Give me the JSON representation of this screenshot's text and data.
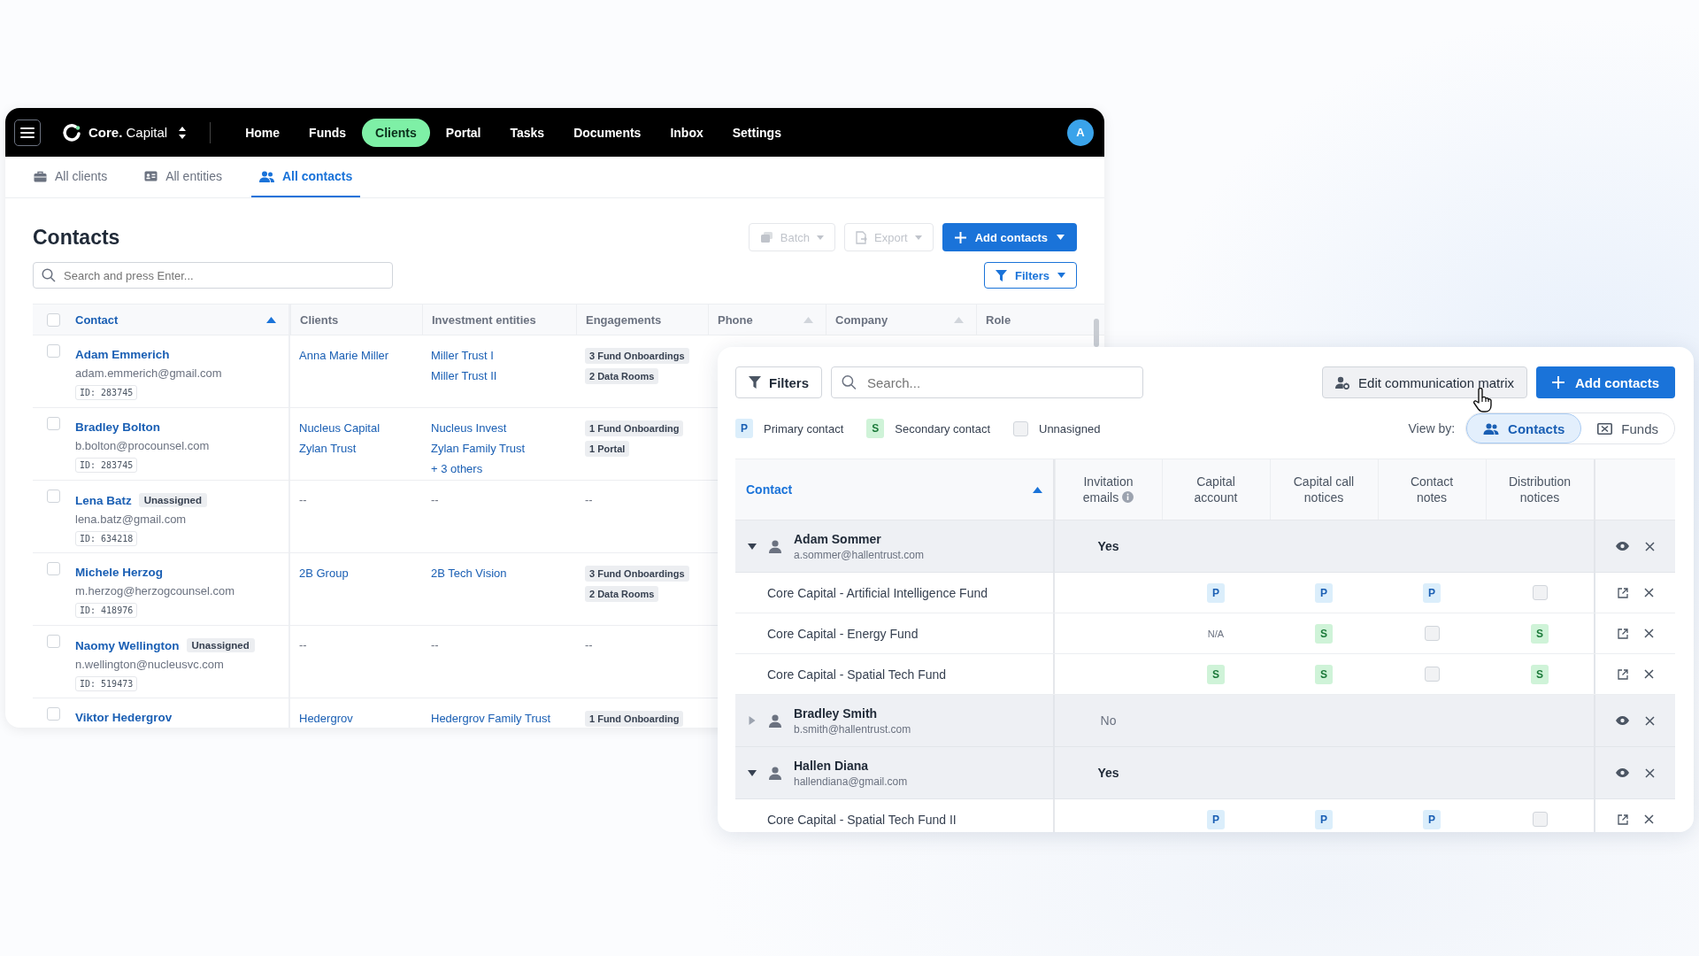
{
  "nav": {
    "brand": "**Core.** Capital",
    "items": [
      {
        "label": "Home",
        "selected": false
      },
      {
        "label": "Funds",
        "selected": false
      },
      {
        "label": "Clients",
        "selected": true
      },
      {
        "label": "Portal",
        "selected": false
      },
      {
        "label": "Tasks",
        "selected": false
      },
      {
        "label": "Documents",
        "selected": false
      },
      {
        "label": "Inbox",
        "selected": false
      },
      {
        "label": "Settings",
        "selected": false
      }
    ],
    "avatar": "A"
  },
  "tabs": [
    {
      "label": "All clients",
      "selected": false
    },
    {
      "label": "All entities",
      "selected": false
    },
    {
      "label": "All contacts",
      "selected": true
    }
  ],
  "contacts_page": {
    "title": "Contacts",
    "tool_buttons": [
      {
        "label": "Batch",
        "disabled": true
      },
      {
        "label": "Export",
        "disabled": true
      }
    ],
    "add_button": "Add contacts",
    "search": {
      "placeholder": "Search and press Enter..."
    },
    "filters_button": "Filters"
  },
  "table": {
    "select_all_checked": false,
    "columns": [
      {
        "label": "Contact",
        "sortable": true,
        "sorted": true
      },
      {
        "label": "Clients",
        "sortable": false,
        "sorted": false
      },
      {
        "label": "Investment entities",
        "sortable": false,
        "sorted": false
      },
      {
        "label": "Engagements",
        "sortable": false,
        "sorted": false
      },
      {
        "label": "Phone",
        "sortable": true,
        "sorted": false
      },
      {
        "label": "Company",
        "sortable": true,
        "sorted": false
      },
      {
        "label": "Role",
        "sortable": false,
        "sorted": false
      }
    ],
    "rows": [
      {
        "checked": false,
        "name": "Adam Emmerich",
        "email": "adam.emmerich@gmail.com",
        "id": "ID: 283745",
        "clients": [
          "Anna Marie Miller"
        ],
        "entities": [
          "Miller Trust I",
          "Miller Trust II"
        ],
        "engagements": [
          "3 Fund Onboardings",
          "2 Data Rooms"
        ]
      },
      {
        "checked": false,
        "name": "Bradley Bolton",
        "email": "b.bolton@procounsel.com",
        "id": "ID: 283745",
        "clients": [
          "Nucleus Capital",
          "Zylan Trust"
        ],
        "entities": [
          "Nucleus Invest",
          "Zylan Family Trust",
          "+ 3 others"
        ],
        "engagements": [
          "1 Fund Onboarding",
          "1 Portal"
        ]
      },
      {
        "checked": false,
        "name": "Lena Batz",
        "badge": "Unassigned",
        "email": "lena.batz@gmail.com",
        "id": "ID: 634218",
        "clients": [
          "--"
        ],
        "entities": [
          "--"
        ],
        "engagements": [
          "--"
        ]
      },
      {
        "checked": false,
        "name": "Michele Herzog",
        "email": "m.herzog@herzogcounsel.com",
        "id": "ID: 418976",
        "clients": [
          "2B Group"
        ],
        "entities": [
          "2B Tech Vision"
        ],
        "engagements": [
          "3 Fund Onboardings",
          "2 Data Rooms"
        ]
      },
      {
        "checked": false,
        "name": "Naomy Wellington",
        "badge": "Unassigned",
        "email": "n.wellington@nucleusvc.com",
        "id": "ID: 519473",
        "clients": [
          "--"
        ],
        "entities": [
          "--"
        ],
        "engagements": [
          "--"
        ]
      },
      {
        "checked": false,
        "name": "Viktor Hedergrov",
        "clients": [
          "Hedergrov"
        ],
        "entities": [
          "Hedergrov Family Trust"
        ],
        "engagements": [
          "1 Fund Onboarding"
        ]
      }
    ]
  },
  "matrix_panel": {
    "filters_button": "Filters",
    "search": {
      "placeholder": "Search..."
    },
    "edit_button": "Edit communication matrix",
    "add_button": "Add contacts",
    "legend": [
      {
        "kind": "primary",
        "mark": "P",
        "label": "Primary contact"
      },
      {
        "kind": "secondary",
        "mark": "S",
        "label": "Secondary contact"
      },
      {
        "kind": "unassigned",
        "label": "Unnasigned"
      }
    ],
    "view_by": {
      "label": "View by:",
      "options": [
        {
          "label": "Contacts",
          "selected": true
        },
        {
          "label": "Funds",
          "selected": false
        }
      ]
    },
    "columns": [
      {
        "label": "Contact",
        "sorted": true
      },
      {
        "label": "Invitation emails",
        "info": true
      },
      {
        "label": "Capital account"
      },
      {
        "label": "Capital call notices"
      },
      {
        "label": "Contact notes"
      },
      {
        "label": "Distribution notices"
      }
    ],
    "contacts": [
      {
        "name": "Adam Sommer",
        "email": "a.sommer@hallentrust.com",
        "expanded": true,
        "invitation": "Yes",
        "invited": true,
        "funds": [
          {
            "name": "Core Capital - Artificial Intelligence Fund",
            "cells": [
              {
                "kind": "primary",
                "text": "P"
              },
              {
                "kind": "primary",
                "text": "P"
              },
              {
                "kind": "primary",
                "text": "P"
              },
              {
                "kind": "unassigned"
              }
            ]
          },
          {
            "name": "Core Capital - Energy Fund",
            "cells": [
              {
                "kind": "na",
                "text": "N/A"
              },
              {
                "kind": "secondary",
                "text": "S"
              },
              {
                "kind": "unassigned"
              },
              {
                "kind": "secondary",
                "text": "S"
              }
            ]
          },
          {
            "name": "Core Capital - Spatial Tech Fund",
            "cells": [
              {
                "kind": "secondary",
                "text": "S"
              },
              {
                "kind": "secondary",
                "text": "S"
              },
              {
                "kind": "unassigned"
              },
              {
                "kind": "secondary",
                "text": "S"
              }
            ]
          }
        ]
      },
      {
        "name": "Bradley Smith",
        "email": "b.smith@hallentrust.com",
        "expanded": false,
        "invitation": "No",
        "invited": false
      },
      {
        "name": "Hallen Diana",
        "email": "hallendiana@gmail.com",
        "expanded": true,
        "invitation": "Yes",
        "invited": true,
        "funds": [
          {
            "name": "Core Capital - Spatial Tech Fund II",
            "cells": [
              {
                "kind": "primary",
                "text": "P"
              },
              {
                "kind": "primary",
                "text": "P"
              },
              {
                "kind": "primary",
                "text": "P"
              },
              {
                "kind": "unassigned"
              }
            ]
          }
        ]
      }
    ]
  }
}
